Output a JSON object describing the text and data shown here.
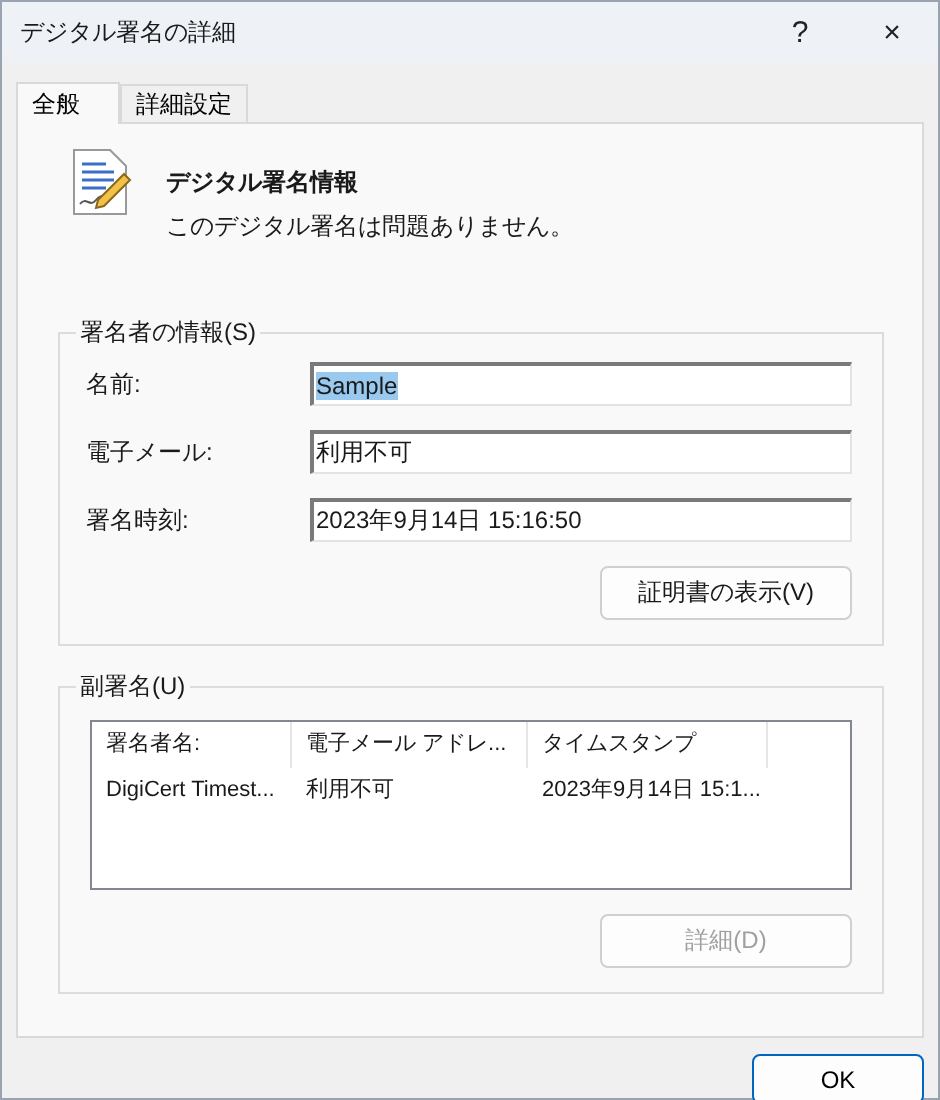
{
  "window": {
    "title": "デジタル署名の詳細",
    "help": "?",
    "close": "×"
  },
  "tabs": [
    {
      "label": "全般",
      "selected": true
    },
    {
      "label": "詳細設定",
      "selected": false
    }
  ],
  "header": {
    "title": "デジタル署名情報",
    "message": "このデジタル署名は問題ありません。"
  },
  "signer_info": {
    "legend": "署名者の情報(S)",
    "fields": [
      {
        "label": "名前:",
        "value": "Sample",
        "text_selected": true
      },
      {
        "label": "電子メール:",
        "value": "利用不可",
        "text_selected": false
      },
      {
        "label": "署名時刻:",
        "value": "2023年9月14日 15:16:50",
        "text_selected": false
      }
    ],
    "button": {
      "label": "証明書の表示(V)",
      "disabled": false
    }
  },
  "countersignatures": {
    "legend": "副署名(U)",
    "columns": [
      "署名者名:",
      "電子メール アドレ...",
      "タイムスタンプ"
    ],
    "rows": [
      {
        "cells": [
          "DigiCert Timest...",
          "利用不可",
          "2023年9月14日 15:1..."
        ],
        "selected": false
      }
    ],
    "button": {
      "label": "詳細(D)",
      "disabled": true
    }
  },
  "footer": {
    "ok": "OK"
  }
}
